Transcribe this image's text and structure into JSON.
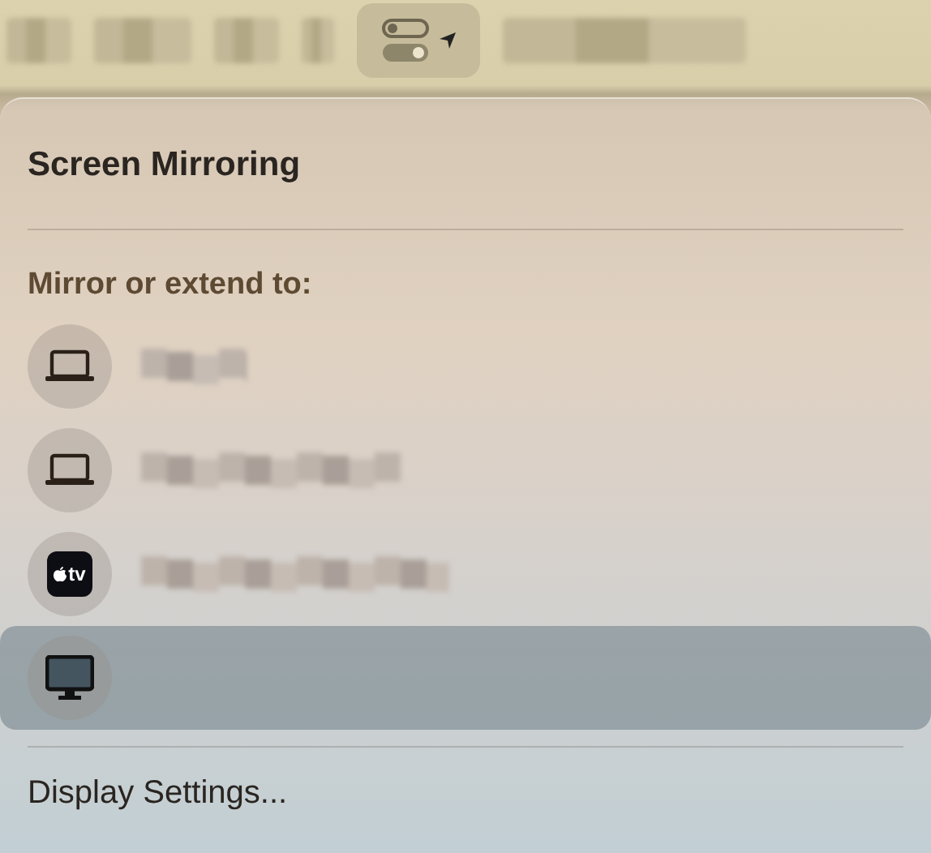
{
  "menu_bar": {
    "control_center_selected": true
  },
  "panel": {
    "title": "Screen Mirroring",
    "section": "Mirror or extend to:",
    "devices": [
      {
        "kind": "laptop",
        "selected": false
      },
      {
        "kind": "laptop",
        "selected": false
      },
      {
        "kind": "tv",
        "label": "tv",
        "selected": false
      },
      {
        "kind": "display",
        "selected": true
      }
    ],
    "footer": "Display Settings..."
  }
}
